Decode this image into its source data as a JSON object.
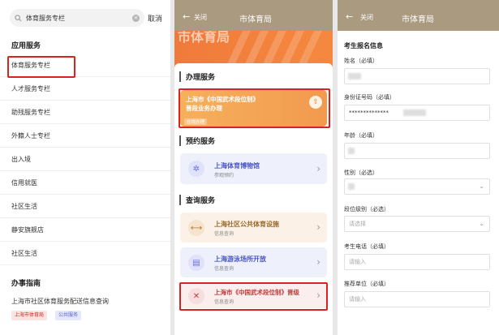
{
  "panel1": {
    "search_text": "体育服务专栏",
    "cancel": "取消",
    "section_app": "应用服务",
    "items": [
      "体育服务专栏",
      "人才服务专栏",
      "助残服务专栏",
      "外籍人士专栏",
      "出入境",
      "信用就医",
      "社区生活",
      "静安旗舰店",
      "社区生活"
    ],
    "section_guide": "办事指南",
    "guide_item": "上海市社区体育服务配送信息查询",
    "guide_tags": [
      "上海市体育局",
      "公共服务"
    ]
  },
  "panel2": {
    "back_label": "关闭",
    "title": "市体育局",
    "banner_text": "市体育局",
    "section1": "办理服务",
    "card1_title": "上海市《中国武术段位制》",
    "card1_title2": "晋段业务办理",
    "card1_badge": "在线办理",
    "section2": "预约服务",
    "card2_title": "上海体育博物馆",
    "card2_sub": "参观预约",
    "section3": "查询服务",
    "card3_title": "上海社区公共体育设施",
    "card3_sub": "信息查询",
    "card4_title": "上海游泳场所开放",
    "card4_sub": "信息查询",
    "card5_title": "上海市《中国武术段位制》晋级",
    "card5_sub": "信息查询"
  },
  "panel3": {
    "back_label": "关闭",
    "title": "市体育局",
    "section": "考生报名信息",
    "name_label": "姓名（必填）",
    "id_label": "身份证号码（必填）",
    "id_value": "**************",
    "age_label": "年龄（必填）",
    "gender_label": "性别（必选）",
    "level_label": "段位级别（必选）",
    "level_placeholder": "请选择",
    "phone_label": "考生电话（必填）",
    "phone_placeholder": "请输入",
    "unit_label": "推荐单位（必填）",
    "unit_placeholder": "请输入"
  },
  "colors": {
    "highlight": "#d8231f",
    "accent_orange": "#f07a3a",
    "header_bg": "#a99a80"
  }
}
